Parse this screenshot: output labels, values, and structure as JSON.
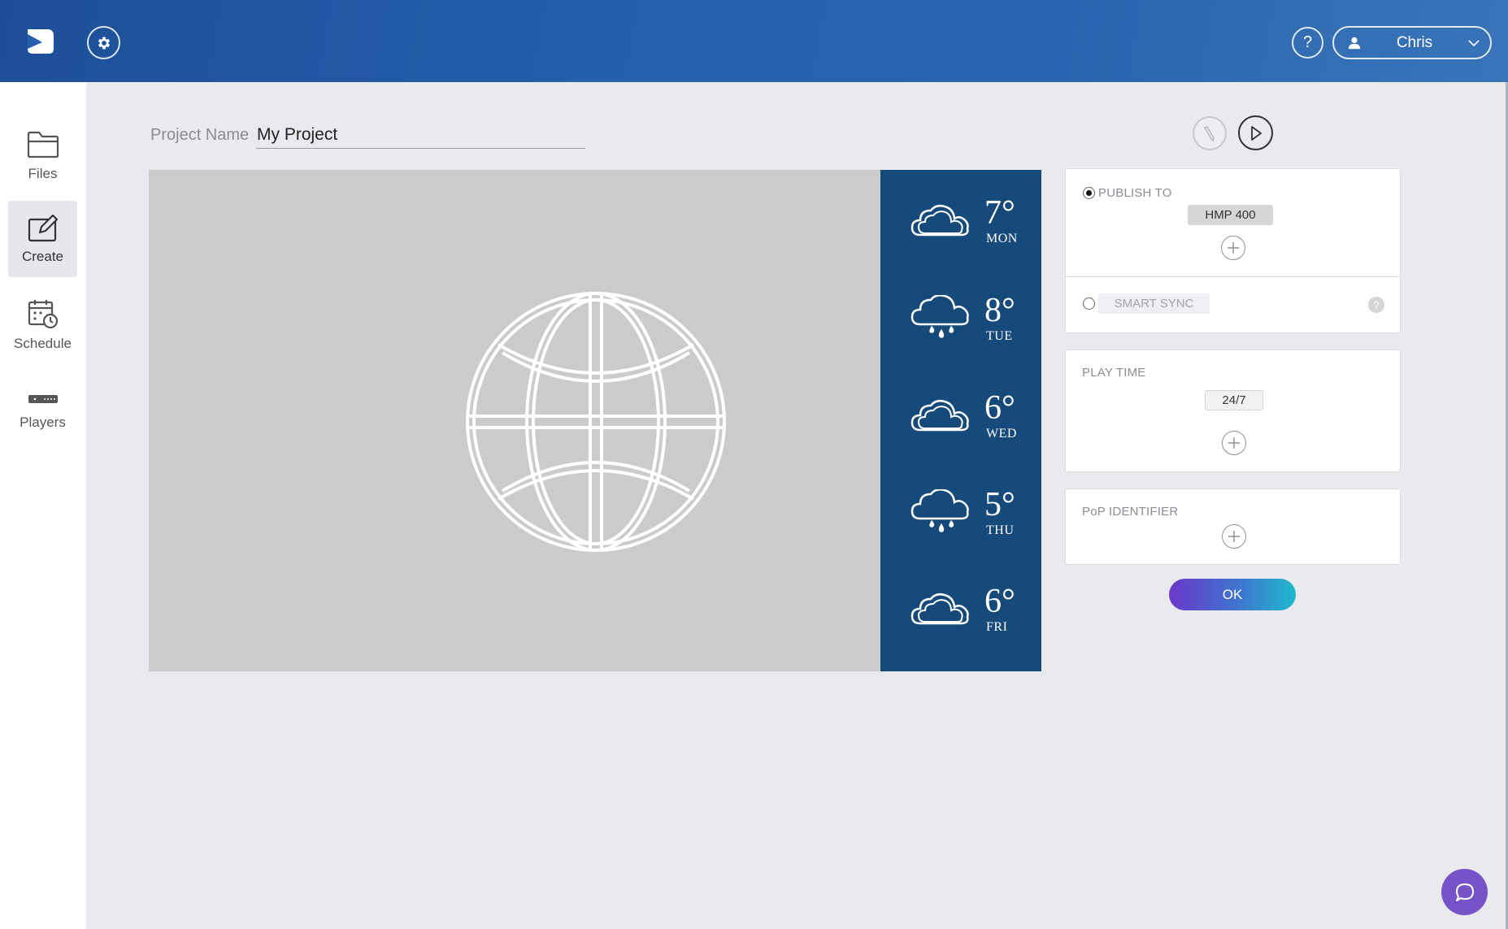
{
  "header": {
    "help_label": "?",
    "user_name": "Chris"
  },
  "sidebar": {
    "items": [
      {
        "label": "Files",
        "icon": "folder-icon"
      },
      {
        "label": "Create",
        "icon": "create-icon",
        "active": true
      },
      {
        "label": "Schedule",
        "icon": "calendar-clock-icon"
      },
      {
        "label": "Players",
        "icon": "player-device-icon"
      }
    ]
  },
  "project": {
    "name_label": "Project Name",
    "name_value": "My Project"
  },
  "preview": {
    "weather": [
      {
        "temp": "7°",
        "day": "MON",
        "icon": "cloud-icon"
      },
      {
        "temp": "8°",
        "day": "TUE",
        "icon": "rain-cloud-icon"
      },
      {
        "temp": "6°",
        "day": "WED",
        "icon": "cloud-icon"
      },
      {
        "temp": "5°",
        "day": "THU",
        "icon": "rain-cloud-icon"
      },
      {
        "temp": "6°",
        "day": "FRI",
        "icon": "cloud-icon"
      }
    ]
  },
  "publish": {
    "publish_to_label": "PUBLISH TO",
    "player_chip": "HMP 400",
    "smart_sync_label": "SMART SYNC",
    "smart_sync_help": "?"
  },
  "playtime": {
    "label": "PLAY TIME",
    "value": "24/7"
  },
  "pop": {
    "label": "PoP IDENTIFIER"
  },
  "actions": {
    "ok_label": "OK"
  },
  "colors": {
    "header": "#2660ac",
    "weather_panel": "#164a7b",
    "preview_bg": "#cbcbcb",
    "chat_button": "#7753c8"
  }
}
